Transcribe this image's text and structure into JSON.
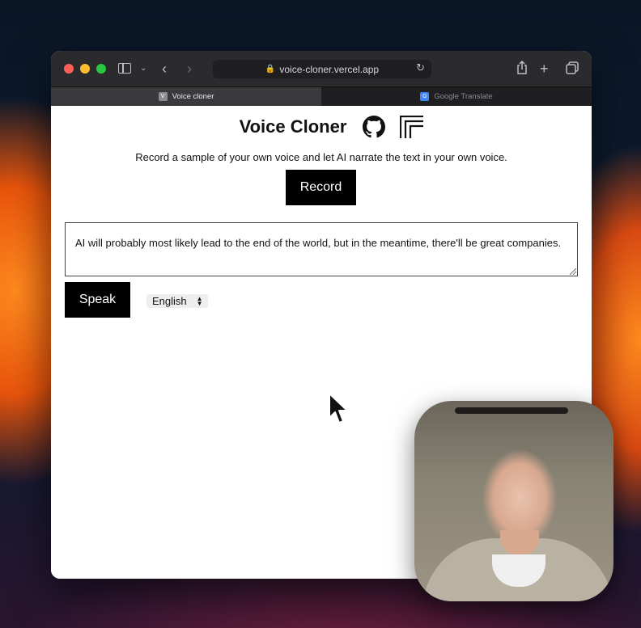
{
  "browser": {
    "url": "voice-cloner.vercel.app",
    "tabs": [
      {
        "label": "Voice cloner",
        "favicon": "V",
        "active": true
      },
      {
        "label": "Google Translate",
        "favicon": "G",
        "active": false
      }
    ]
  },
  "app": {
    "title": "Voice Cloner",
    "subtitle": "Record a sample of your own voice and let AI narrate the text in your own voice.",
    "record_label": "Record",
    "text_value": "AI will probably most likely lead to the end of the world, but in the meantime, there'll be great companies.",
    "speak_label": "Speak",
    "language": {
      "selected": "English"
    }
  },
  "icons": {
    "github": "github-icon",
    "logo": "brand-logo-icon",
    "lock": "lock-icon",
    "reload": "reload-icon",
    "share": "share-icon",
    "new_tab": "plus-icon",
    "tabs_overview": "tabs-icon"
  },
  "colors": {
    "button_bg": "#000000",
    "button_text": "#ffffff",
    "toolbar_bg": "#2b2b2e"
  }
}
